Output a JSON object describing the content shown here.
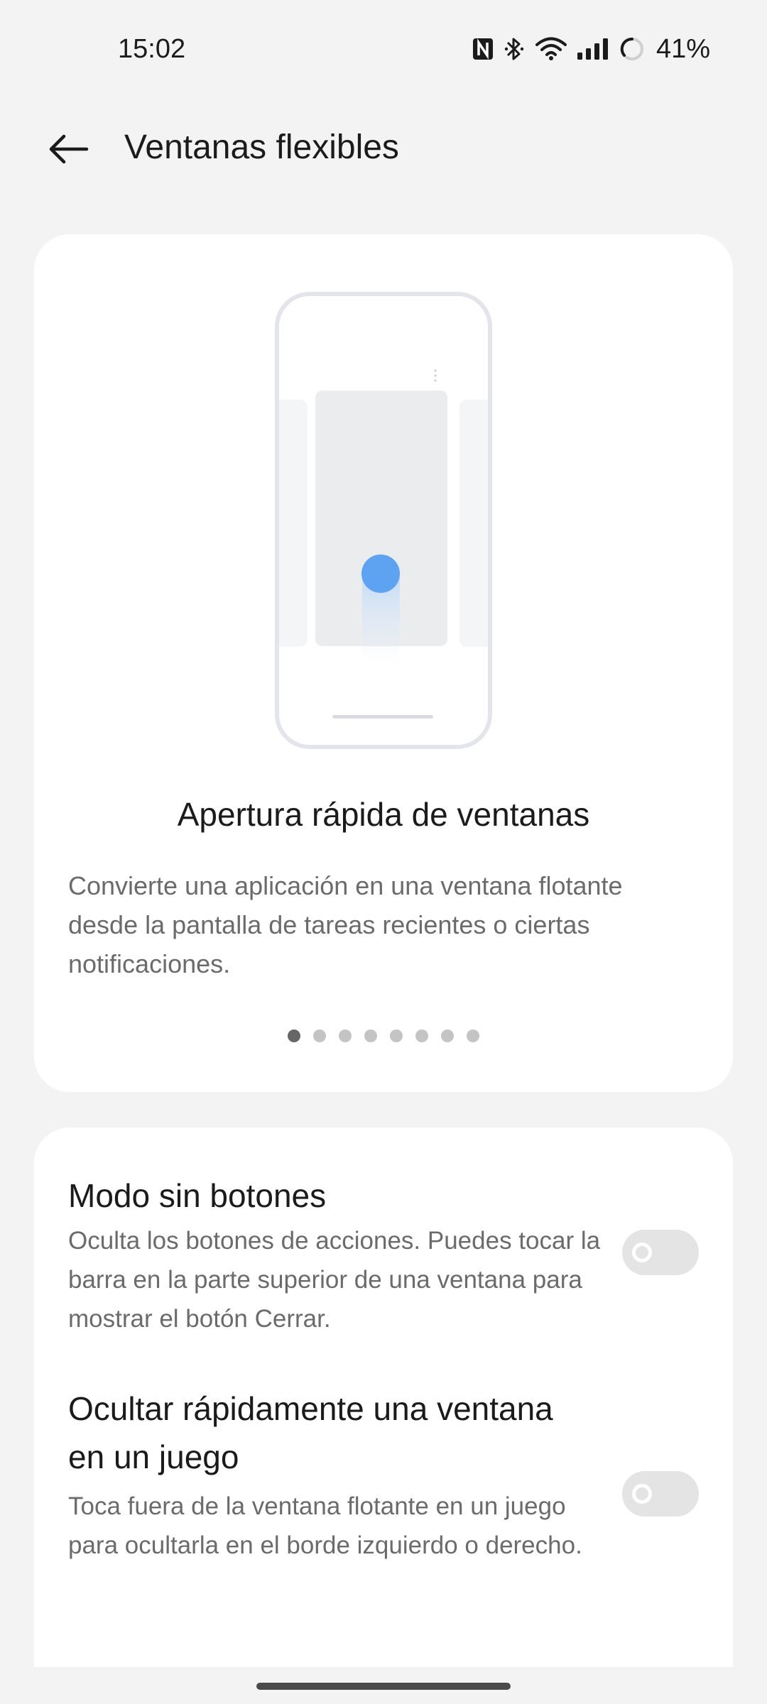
{
  "status_bar": {
    "time": "15:02",
    "battery": "41%",
    "icons": [
      "nfc-icon",
      "bluetooth-icon",
      "wifi-icon",
      "signal-icon",
      "battery-ring-icon"
    ]
  },
  "app_bar": {
    "back_icon": "arrow-left-icon",
    "title": "Ventanas flexibles"
  },
  "feature_card": {
    "title": "Apertura rápida de ventanas",
    "description": "Convierte una aplicación en una ventana flotante desde la pantalla de tareas recientes o ciertas notificaciones.",
    "page_count": 8,
    "active_page": 1
  },
  "settings": [
    {
      "title": "Modo sin botones",
      "description": "Oculta los botones de acciones. Puedes tocar la barra en la parte superior de una ventana para mostrar el botón Cerrar.",
      "enabled": false
    },
    {
      "title": "Ocultar rápidamente una ventana en un juego",
      "description": "Toca fuera de la ventana flotante en un juego para ocultarla en el borde izquierdo o derecho.",
      "enabled": false
    }
  ],
  "colors": {
    "accent": "#5ea3f2",
    "background": "#f3f3f3",
    "card": "#ffffff",
    "toggle_off": "#e4e4e4"
  }
}
